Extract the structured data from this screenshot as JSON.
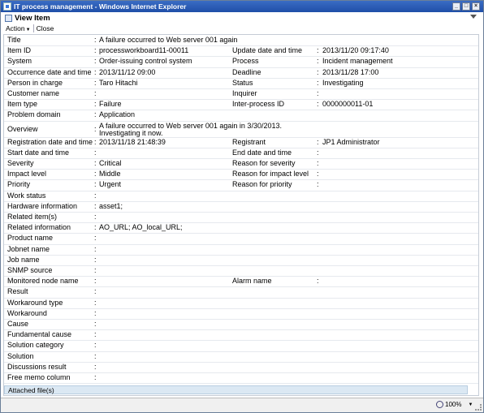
{
  "window": {
    "title": "IT process management - Windows Internet Explorer",
    "buttons": {
      "minimize": "_",
      "maximize": "□",
      "close": "×"
    }
  },
  "view": {
    "title": "View Item"
  },
  "toolbar": {
    "action_label": "Action",
    "close_label": "Close"
  },
  "fields": [
    {
      "label": "Title",
      "value": "A failure occurred to Web server 001 again"
    },
    {
      "label": "Item ID",
      "value": "processworkboard11-00011",
      "label2": "Update date and time",
      "value2": "2013/11/20 09:17:40"
    },
    {
      "label": "System",
      "value": "Order-issuing control system",
      "label2": "Process",
      "value2": "Incident management"
    },
    {
      "label": "Occurrence date and time",
      "value": "2013/11/12 09:00",
      "label2": "Deadline",
      "value2": "2013/11/28 17:00"
    },
    {
      "label": "Person in charge",
      "value": "Taro Hitachi",
      "label2": "Status",
      "value2": "Investigating"
    },
    {
      "label": "Customer name",
      "value": "",
      "label2": "Inquirer",
      "value2": ""
    },
    {
      "label": "Item type",
      "value": "Failure",
      "label2": "Inter-process ID",
      "value2": "0000000011-01"
    },
    {
      "label": "Problem domain",
      "value": "Application"
    },
    {
      "label": "Overview",
      "value": "A failure occurred to Web server 001 again in 3/30/2013.",
      "value_line2": "Investigating it now."
    },
    {
      "label": "Registration date and time",
      "value": "2013/11/18 21:48:39",
      "label2": "Registrant",
      "value2": "JP1 Administrator"
    },
    {
      "label": "Start date and time",
      "value": "",
      "label2": "End date and time",
      "value2": ""
    },
    {
      "label": "Severity",
      "value": "Critical",
      "label2": "Reason for severity",
      "value2": ""
    },
    {
      "label": "Impact level",
      "value": "Middle",
      "label2": "Reason for impact level",
      "value2": ""
    },
    {
      "label": "Priority",
      "value": "Urgent",
      "label2": "Reason for priority",
      "value2": ""
    },
    {
      "label": "Work status",
      "value": ""
    },
    {
      "label": "Hardware information",
      "value": "asset1;"
    },
    {
      "label": "Related item(s)",
      "value": ""
    },
    {
      "label": "Related information",
      "value": "AO_URL; AO_local_URL;"
    },
    {
      "label": "Product name",
      "value": ""
    },
    {
      "label": "Jobnet name",
      "value": ""
    },
    {
      "label": "Job name",
      "value": ""
    },
    {
      "label": "SNMP source",
      "value": ""
    },
    {
      "label": "Monitored node name",
      "value": "",
      "label2": "Alarm name",
      "value2": ""
    },
    {
      "label": "Result",
      "value": ""
    },
    {
      "label": "Workaround type",
      "value": ""
    },
    {
      "label": "Workaround",
      "value": ""
    },
    {
      "label": "Cause",
      "value": ""
    },
    {
      "label": "Fundamental cause",
      "value": ""
    },
    {
      "label": "Solution category",
      "value": ""
    },
    {
      "label": "Solution",
      "value": ""
    },
    {
      "label": "Discussions result",
      "value": ""
    },
    {
      "label": "Free memo column",
      "value": ""
    }
  ],
  "colon": ":",
  "attachments": {
    "label": "Attached file(s)"
  },
  "statusbar": {
    "zoom": "100%"
  }
}
